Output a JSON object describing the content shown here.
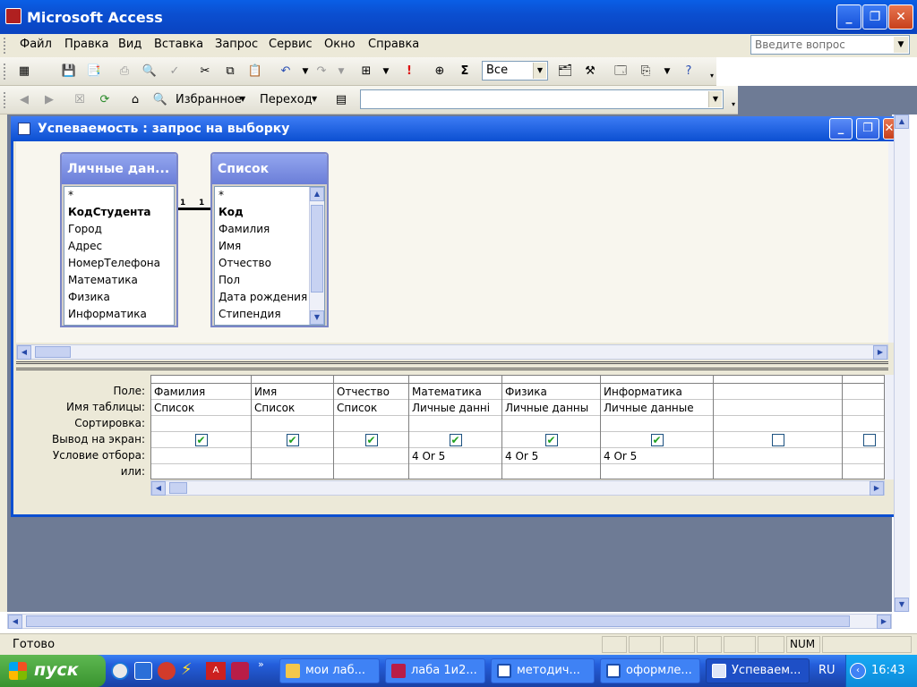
{
  "window": {
    "title": "Microsoft Access"
  },
  "menu": [
    "Файл",
    "Правка",
    "Вид",
    "Вставка",
    "Запрос",
    "Сервис",
    "Окно",
    "Справка"
  ],
  "help_placeholder": "Введите вопрос",
  "toolbar1": {
    "top_values": "Все"
  },
  "toolbar2": {
    "favorites": "Избранное",
    "goto": "Переход"
  },
  "child": {
    "title": "Успеваемость : запрос на выборку"
  },
  "tables": [
    {
      "title": "Личные дан...",
      "fields": [
        "*",
        "КодСтудента",
        "Город",
        "Адрес",
        "НомерТелефона",
        "Математика",
        "Физика",
        "Информатика"
      ],
      "key": "КодСтудента"
    },
    {
      "title": "Список",
      "fields": [
        "*",
        "Код",
        "Фамилия",
        "Имя",
        "Отчество",
        "Пол",
        "Дата рождения",
        "Стипендия"
      ],
      "key": "Код"
    }
  ],
  "relation": {
    "left": "1",
    "right": "1"
  },
  "grid": {
    "row_labels": [
      "Поле:",
      "Имя таблицы:",
      "Сортировка:",
      "Вывод на экран:",
      "Условие отбора:",
      "или:"
    ],
    "columns": [
      {
        "field": "Фамилия",
        "table": "Список",
        "sort": "",
        "show": true,
        "criteria": "",
        "or": ""
      },
      {
        "field": "Имя",
        "table": "Список",
        "sort": "",
        "show": true,
        "criteria": "",
        "or": ""
      },
      {
        "field": "Отчество",
        "table": "Список",
        "sort": "",
        "show": true,
        "criteria": "",
        "or": ""
      },
      {
        "field": "Математика",
        "table": "Личные данні",
        "sort": "",
        "show": true,
        "criteria": "4 Or 5",
        "or": ""
      },
      {
        "field": "Физика",
        "table": "Личные данны",
        "sort": "",
        "show": true,
        "criteria": "4 Or 5",
        "or": ""
      },
      {
        "field": "Информатика",
        "table": "Личные данные",
        "sort": "",
        "show": true,
        "criteria": "4 Or 5",
        "or": ""
      },
      {
        "field": "",
        "table": "",
        "sort": "",
        "show": false,
        "criteria": "",
        "or": ""
      },
      {
        "field": "",
        "table": "",
        "sort": "",
        "show": false,
        "criteria": "",
        "or": ""
      }
    ]
  },
  "status": {
    "text": "Готово",
    "num": "NUM"
  },
  "taskbar": {
    "start": "пуск",
    "tasks": [
      "мои лаб...",
      "лаба 1и2...",
      "методич...",
      "оформле...",
      "Успеваем..."
    ],
    "lang": "RU",
    "time": "16:43"
  },
  "colors": {
    "title_blue": "#0b4fd1",
    "check_green": "#21a121",
    "taskbar": "#245edb",
    "start_green": "#39932f"
  }
}
